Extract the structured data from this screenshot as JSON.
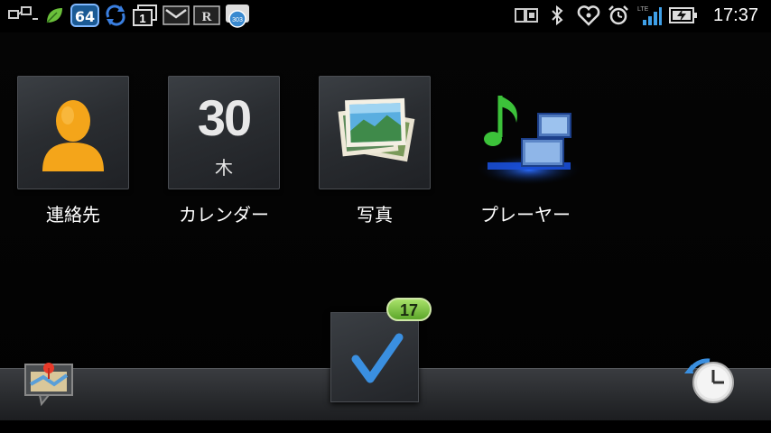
{
  "status_bar": {
    "time": "17:37",
    "battery_badge": "64",
    "left_icons": [
      "network-icon",
      "leaf-icon",
      "badge-64",
      "sync-icon",
      "window-count-icon",
      "mail-icon",
      "r-icon",
      "weather-icon"
    ],
    "window_count": "1",
    "right_icons": [
      "usb-debug-icon",
      "bluetooth-icon",
      "health-icon",
      "alarm-icon",
      "lte-signal-icon",
      "battery-charging-icon"
    ],
    "lte_label": "LTE",
    "weather_label": "303"
  },
  "apps": [
    {
      "label": "連絡先",
      "icon": "contacts-icon"
    },
    {
      "label": "カレンダー",
      "icon": "calendar-icon",
      "date": "30",
      "weekday": "木"
    },
    {
      "label": "写真",
      "icon": "photos-icon"
    },
    {
      "label": "プレーヤー",
      "icon": "music-player-icon"
    }
  ],
  "dock": {
    "left": {
      "icon": "map-pin-icon"
    },
    "center": {
      "icon": "checkmark-icon",
      "badge": "17"
    },
    "right": {
      "icon": "clock-icon"
    }
  },
  "colors": {
    "background": "#000000",
    "contact_orange": "#f2a11a",
    "badge_green": "#7cc544",
    "check_blue": "#3a8fe0",
    "music_green": "#3cc23a"
  }
}
